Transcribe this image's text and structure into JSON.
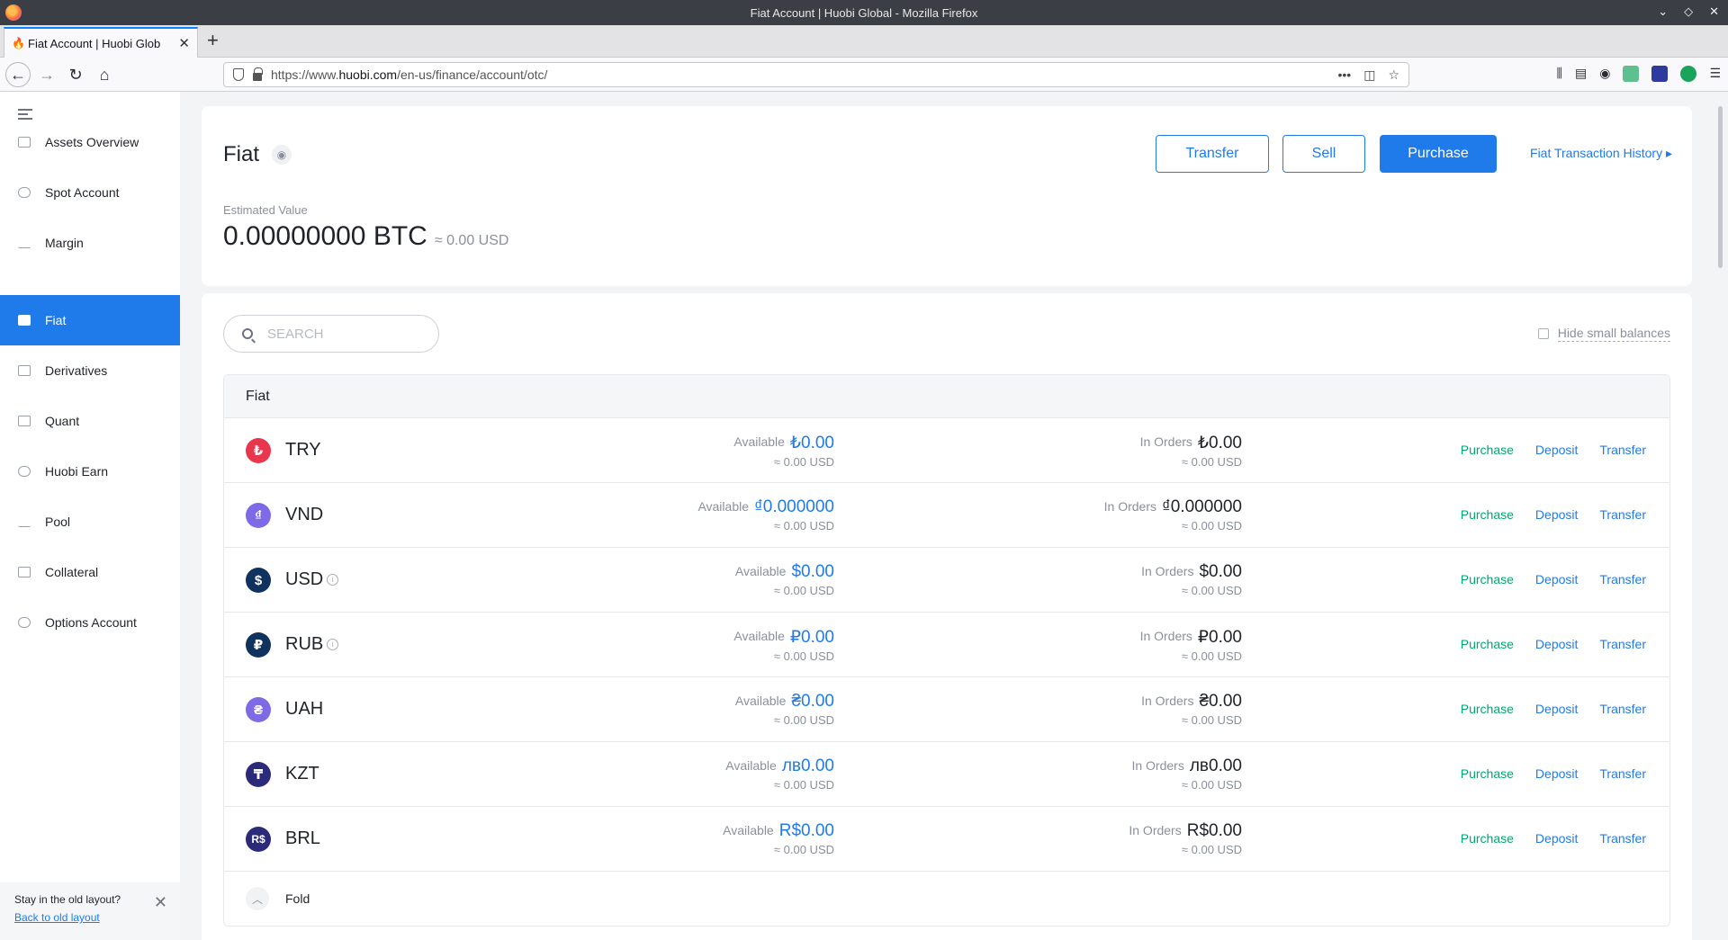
{
  "browser": {
    "window_title": "Fiat Account | Huobi Global - Mozilla Firefox",
    "tab_title": "Fiat Account | Huobi Glob",
    "url_prefix": "https://www.",
    "url_domain": "huobi.com",
    "url_path": "/en-us/finance/account/otc/"
  },
  "sidebar": {
    "items": [
      {
        "label": "Assets Overview",
        "icon": "assets-icon"
      },
      {
        "label": "Spot Account",
        "icon": "spot-icon"
      },
      {
        "label": "Margin",
        "icon": "margin-icon"
      },
      {
        "label": "Fiat",
        "icon": "fiat-icon"
      },
      {
        "label": "Derivatives",
        "icon": "derivatives-icon"
      },
      {
        "label": "Quant",
        "icon": "quant-icon"
      },
      {
        "label": "Huobi Earn",
        "icon": "earn-icon"
      },
      {
        "label": "Pool",
        "icon": "pool-icon"
      },
      {
        "label": "Collateral",
        "icon": "collateral-icon"
      },
      {
        "label": "Options Account",
        "icon": "options-icon"
      }
    ],
    "old_layout_text": "Stay in the old layout?",
    "old_layout_link": "Back to old layout"
  },
  "header": {
    "title": "Fiat",
    "transfer_label": "Transfer",
    "sell_label": "Sell",
    "purchase_label": "Purchase",
    "history_label": "Fiat Transaction History",
    "estimated_label": "Estimated Value",
    "estimated_btc": "0.00000000 BTC",
    "estimated_usd": "≈ 0.00 USD"
  },
  "filters": {
    "search_placeholder": "SEARCH",
    "hide_small_label": "Hide small balances"
  },
  "table": {
    "section_title": "Fiat",
    "available_label": "Available",
    "orders_label": "In Orders",
    "purchase_label": "Purchase",
    "deposit_label": "Deposit",
    "transfer_label": "Transfer",
    "fold_label": "Fold",
    "rows": [
      {
        "code": "TRY",
        "symbol": "₺",
        "color": "#e8364d",
        "available": "₺0.00",
        "available_usd": "≈ 0.00 USD",
        "orders": "₺0.00",
        "orders_usd": "≈ 0.00 USD"
      },
      {
        "code": "VND",
        "symbol": "₫",
        "color": "#7e6ae6",
        "available": "₫0.000000",
        "available_usd": "≈ 0.00 USD",
        "orders": "₫0.000000",
        "orders_usd": "≈ 0.00 USD"
      },
      {
        "code": "USD",
        "symbol": "$",
        "color": "#10325f",
        "available": "$0.00",
        "available_usd": "≈ 0.00 USD",
        "orders": "$0.00",
        "orders_usd": "≈ 0.00 USD"
      },
      {
        "code": "RUB",
        "symbol": "₽",
        "color": "#10325f",
        "available": "₽0.00",
        "available_usd": "≈ 0.00 USD",
        "orders": "₽0.00",
        "orders_usd": "≈ 0.00 USD"
      },
      {
        "code": "UAH",
        "symbol": "₴",
        "color": "#7e6ae6",
        "available": "₴0.00",
        "available_usd": "≈ 0.00 USD",
        "orders": "₴0.00",
        "orders_usd": "≈ 0.00 USD"
      },
      {
        "code": "KZT",
        "symbol": "₸",
        "color": "#2c2b7a",
        "available": "лв0.00",
        "available_usd": "≈ 0.00 USD",
        "orders": "лв0.00",
        "orders_usd": "≈ 0.00 USD"
      },
      {
        "code": "BRL",
        "symbol": "R$",
        "color": "#2c2b7a",
        "available": "R$0.00",
        "available_usd": "≈ 0.00 USD",
        "orders": "R$0.00",
        "orders_usd": "≈ 0.00 USD"
      }
    ]
  }
}
